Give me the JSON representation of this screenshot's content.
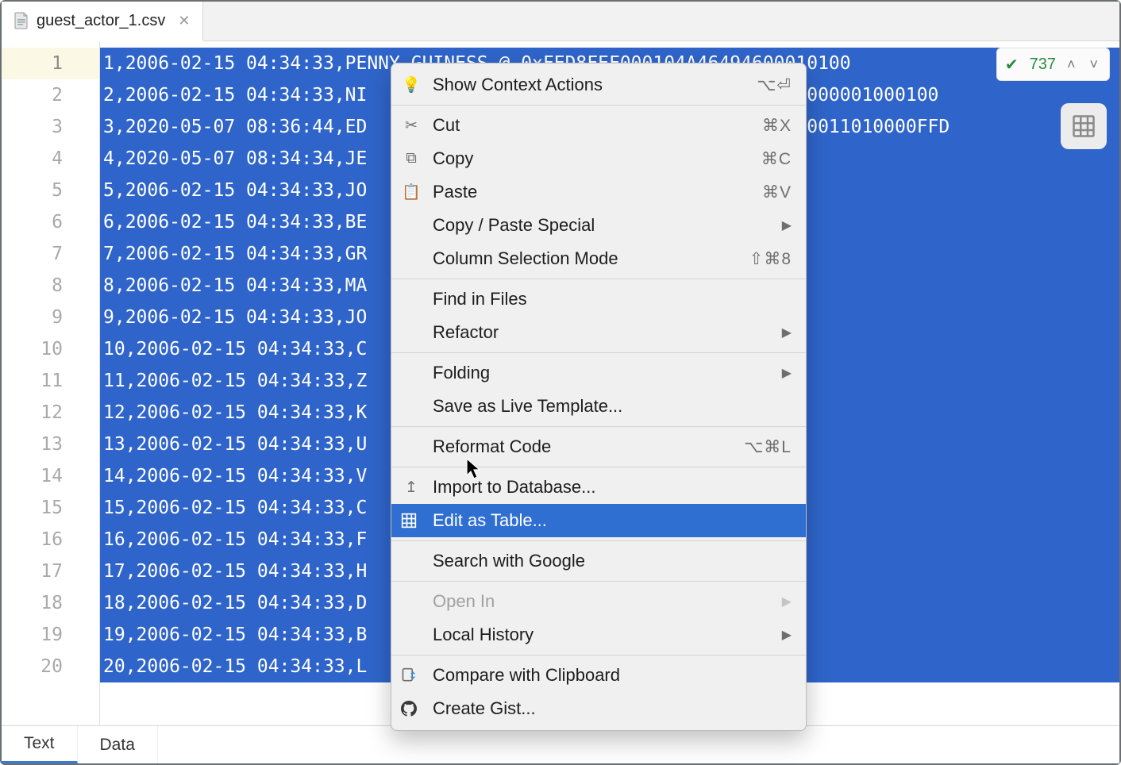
{
  "tab": {
    "filename": "guest_actor_1.csv"
  },
  "gutter": {
    "count": 20,
    "current": 1
  },
  "lines": [
    "1,2006-02-15 04:34:33,PENNY,GUINESS,@,0xFED8FEF000104A46494600010100",
    "2,2006-02-15 04:34:33,NI                                46000101000001000100",
    "3,2020-05-07 08:36:44,ED                                001010000011010000FFD",
    "4,2020-05-07 08:34:34,JE",
    "5,2006-02-15 04:34:33,JO",
    "6,2006-02-15 04:34:33,BE",
    "7,2006-02-15 04:34:33,GR",
    "8,2006-02-15 04:34:33,MA",
    "9,2006-02-15 04:34:33,JO",
    "10,2006-02-15 04:34:33,C",
    "11,2006-02-15 04:34:33,Z",
    "12,2006-02-15 04:34:33,K",
    "13,2006-02-15 04:34:33,U",
    "14,2006-02-15 04:34:33,V",
    "15,2006-02-15 04:34:33,C",
    "16,2006-02-15 04:34:33,F",
    "17,2006-02-15 04:34:33,H",
    "18,2006-02-15 04:34:33,D",
    "19,2006-02-15 04:34:33,B",
    "20,2006-02-15 04:34:33,L"
  ],
  "inspection": {
    "count": "737"
  },
  "bottom": {
    "text": "Text",
    "data": "Data"
  },
  "menu": {
    "show_context_actions": "Show Context Actions",
    "show_context_actions_sc": "⌥⏎",
    "cut": "Cut",
    "cut_sc": "⌘X",
    "copy": "Copy",
    "copy_sc": "⌘C",
    "paste": "Paste",
    "paste_sc": "⌘V",
    "copy_paste_special": "Copy / Paste Special",
    "column_selection": "Column Selection Mode",
    "column_selection_sc": "⇧⌘8",
    "find_in_files": "Find in Files",
    "refactor": "Refactor",
    "folding": "Folding",
    "save_live_template": "Save as Live Template...",
    "reformat_code": "Reformat Code",
    "reformat_code_sc": "⌥⌘L",
    "import_db": "Import to Database...",
    "edit_as_table": "Edit as Table...",
    "search_google": "Search with Google",
    "open_in": "Open In",
    "local_history": "Local History",
    "compare_clipboard": "Compare with Clipboard",
    "create_gist": "Create Gist..."
  }
}
